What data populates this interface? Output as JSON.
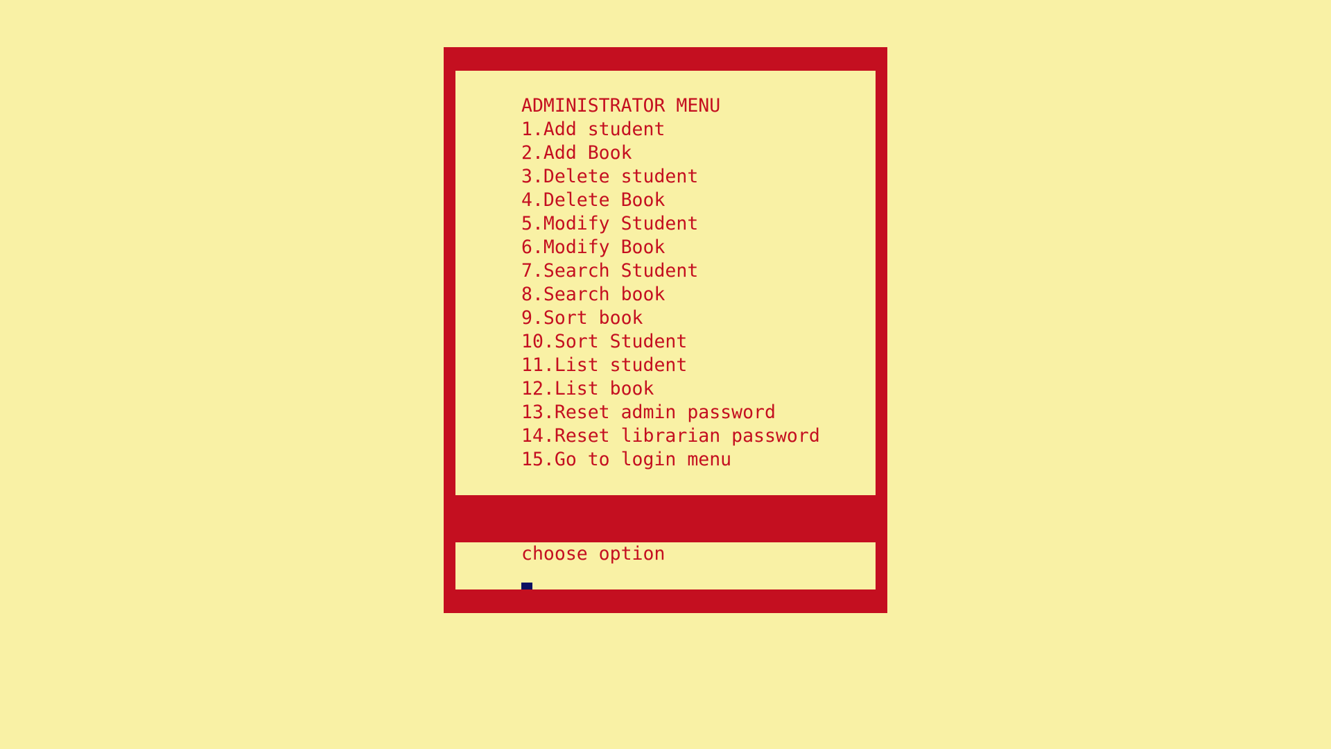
{
  "colors": {
    "background": "#f9f1a5",
    "frame": "#c40f20",
    "text": "#c40f20",
    "cursor": "#0c1062"
  },
  "menu": {
    "title": "ADMINISTRATOR MENU",
    "items": [
      {
        "label": "1.Add student"
      },
      {
        "label": "2.Add Book"
      },
      {
        "label": "3.Delete student"
      },
      {
        "label": "4.Delete Book"
      },
      {
        "label": "5.Modify Student"
      },
      {
        "label": "6.Modify Book"
      },
      {
        "label": "7.Search Student"
      },
      {
        "label": "8.Search book"
      },
      {
        "label": "9.Sort book"
      },
      {
        "label": "10.Sort Student"
      },
      {
        "label": "11.List student"
      },
      {
        "label": "12.List book"
      },
      {
        "label": "13.Reset admin password"
      },
      {
        "label": "14.Reset librarian password"
      },
      {
        "label": "15.Go to login menu"
      }
    ]
  },
  "prompt": {
    "text": "choose option"
  }
}
